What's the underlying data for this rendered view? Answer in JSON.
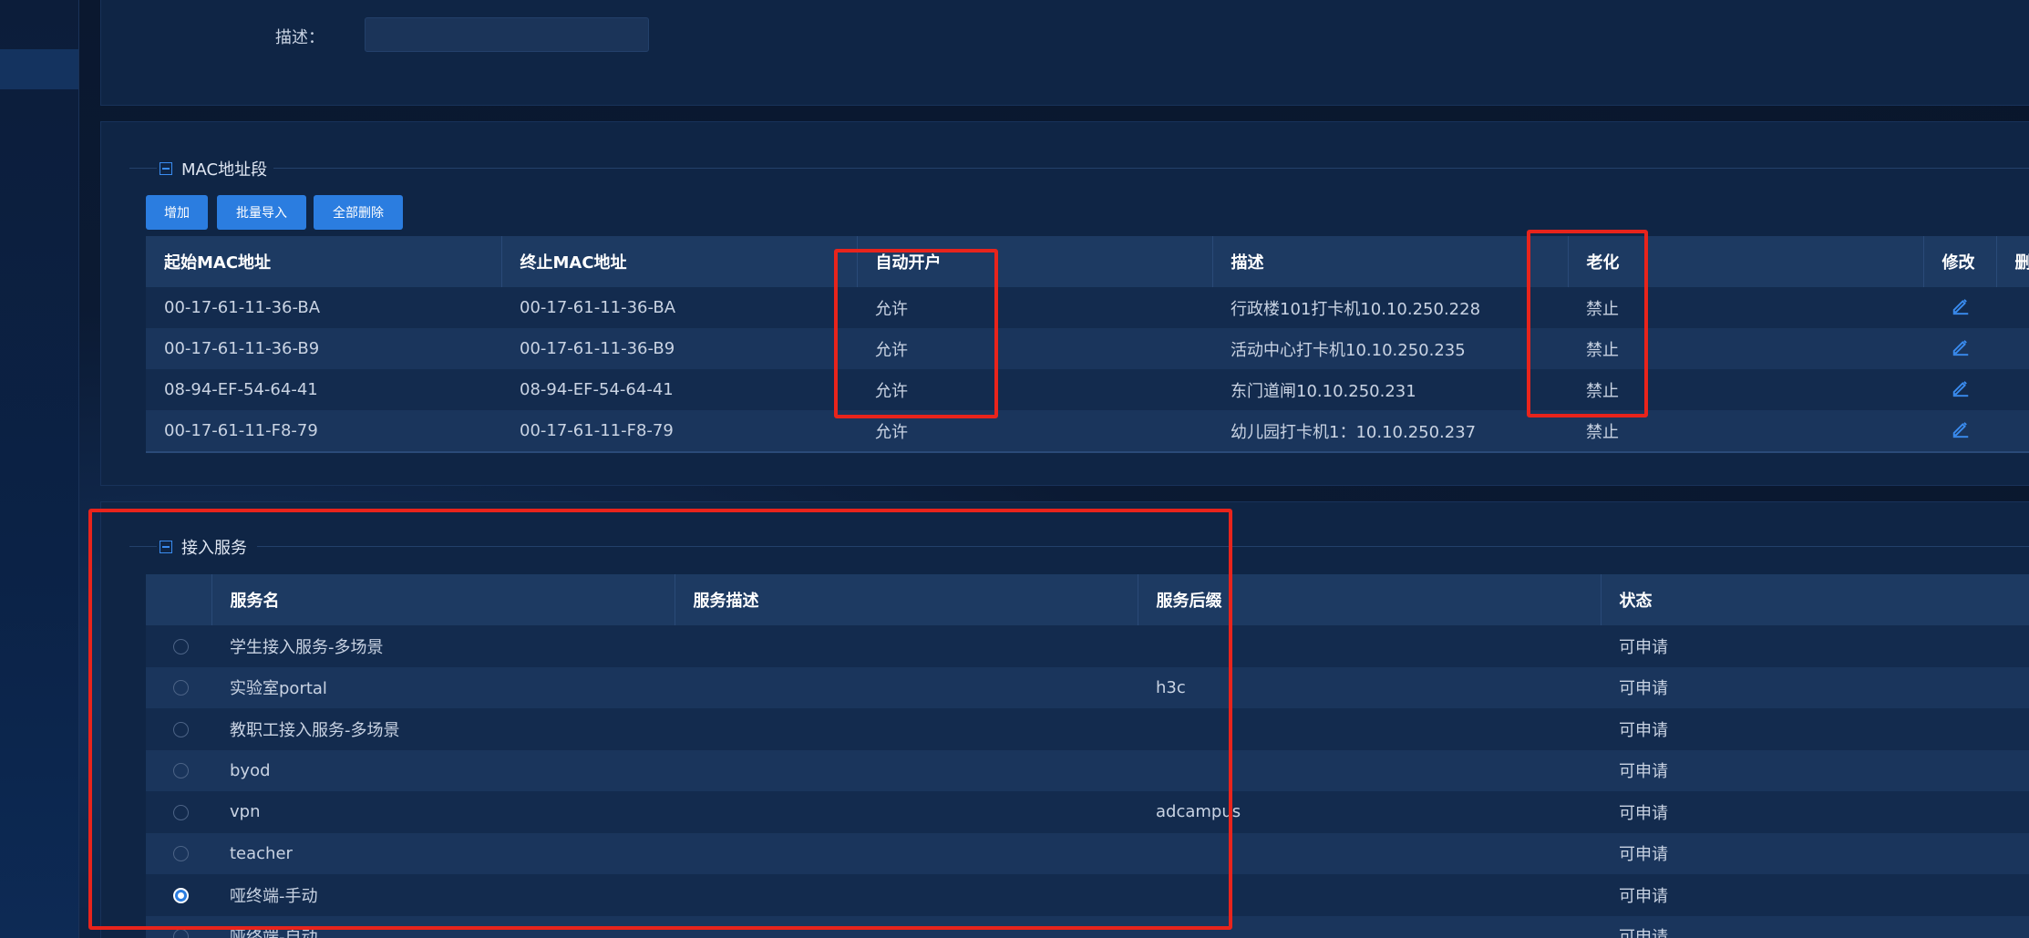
{
  "top_section": {
    "description_label": "描述：",
    "description_value": ""
  },
  "mac_section": {
    "title": "MAC地址段",
    "buttons": {
      "add": "增加",
      "batch_import": "批量导入",
      "delete_all": "全部删除"
    },
    "columns": [
      "起始MAC地址",
      "终止MAC地址",
      "自动开户",
      "描述",
      "老化",
      "修改",
      "删"
    ],
    "rows": [
      {
        "start": "00-17-61-11-36-BA",
        "end": "00-17-61-11-36-BA",
        "auto": "允许",
        "desc": "行政楼101打卡机10.10.250.228",
        "aging": "禁止"
      },
      {
        "start": "00-17-61-11-36-B9",
        "end": "00-17-61-11-36-B9",
        "auto": "允许",
        "desc": "活动中心打卡机10.10.250.235",
        "aging": "禁止"
      },
      {
        "start": "08-94-EF-54-64-41",
        "end": "08-94-EF-54-64-41",
        "auto": "允许",
        "desc": "东门道闸10.10.250.231",
        "aging": "禁止"
      },
      {
        "start": "00-17-61-11-F8-79",
        "end": "00-17-61-11-F8-79",
        "auto": "允许",
        "desc": "幼儿园打卡机1：10.10.250.237",
        "aging": "禁止"
      }
    ],
    "edit_icon": "pencil-icon"
  },
  "service_section": {
    "title": "接入服务",
    "columns": [
      "",
      "服务名",
      "服务描述",
      "服务后缀",
      "状态"
    ],
    "rows": [
      {
        "name": "学生接入服务-多场景",
        "desc": "",
        "suffix": "",
        "status": "可申请",
        "selected": false
      },
      {
        "name": "实验室portal",
        "desc": "",
        "suffix": "h3c",
        "status": "可申请",
        "selected": false
      },
      {
        "name": "教职工接入服务-多场景",
        "desc": "",
        "suffix": "",
        "status": "可申请",
        "selected": false
      },
      {
        "name": "byod",
        "desc": "",
        "suffix": "",
        "status": "可申请",
        "selected": false
      },
      {
        "name": "vpn",
        "desc": "",
        "suffix": "adcampus",
        "status": "可申请",
        "selected": false
      },
      {
        "name": "teacher",
        "desc": "",
        "suffix": "",
        "status": "可申请",
        "selected": false
      },
      {
        "name": "哑终端-手动",
        "desc": "",
        "suffix": "",
        "status": "可申请",
        "selected": true
      },
      {
        "name": "哑终端-自动",
        "desc": "",
        "suffix": "",
        "status": "可申请",
        "selected": false
      }
    ]
  },
  "colors": {
    "highlight": "#e8241c",
    "accent": "#2b7de0"
  }
}
